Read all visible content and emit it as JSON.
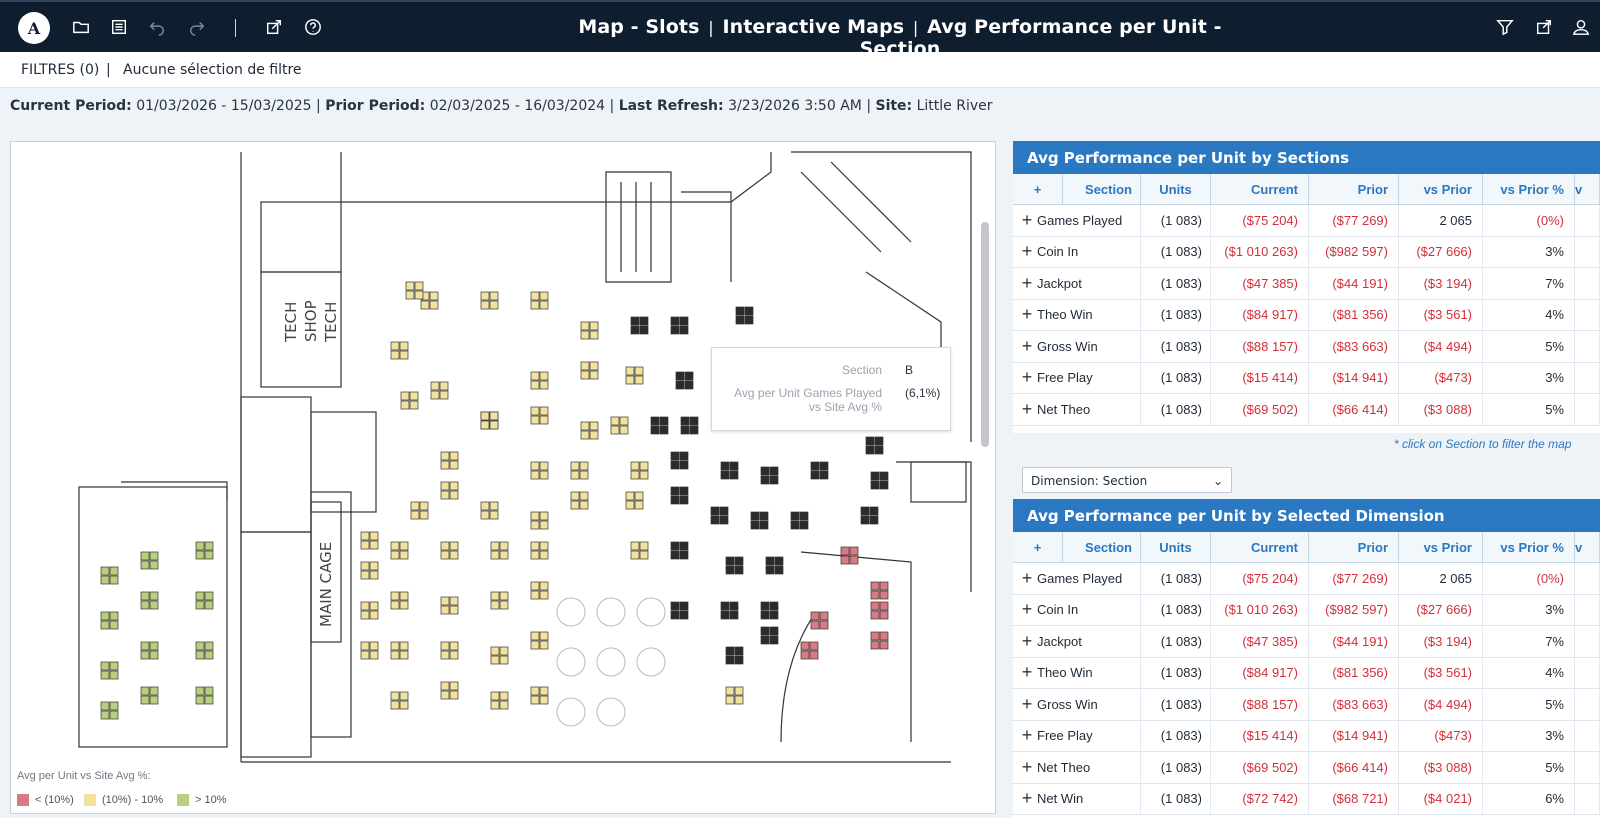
{
  "header": {
    "logo_text": "A",
    "title_parts": [
      "Map - Slots",
      "Interactive Maps",
      "Avg Performance per Unit - Section"
    ],
    "title_separator": "|"
  },
  "toolbar": {
    "left_icons": [
      "folder-icon",
      "list-icon",
      "undo-icon",
      "redo-icon",
      "divider",
      "export-icon",
      "help-icon"
    ],
    "right_icons": [
      "filter-icon",
      "share-icon",
      "user-icon"
    ]
  },
  "filters": {
    "label": "FILTRES (0)",
    "separator": "|",
    "value": "Aucune sélection de filtre"
  },
  "period": {
    "current_label": "Current Period:",
    "current_value": "01/03/2026 - 15/03/2025",
    "prior_label": "Prior Period:",
    "prior_value": "02/03/2025 - 16/03/2024",
    "refresh_label": "Last Refresh:",
    "refresh_value": "3/23/2026 3:50 AM",
    "site_label": "Site:",
    "site_value": "Little River",
    "sep": "|"
  },
  "map": {
    "labels": {
      "tech": "TECH",
      "shop": "SHOP",
      "tech2": "TECH",
      "main_cage": "MAIN CAGE"
    },
    "tooltip": {
      "k1": "Section",
      "v1": "B",
      "k2": "Avg per Unit Games Played",
      "k3": "vs Site Avg %",
      "v2": "(6,1%)"
    },
    "legend": {
      "title": "Avg per Unit vs Site Avg %:",
      "items": [
        {
          "label": "< (10%)",
          "color": "#d97b83"
        },
        {
          "label": "(10%) - 10%",
          "color": "#f2e2a0"
        },
        {
          "label": "> 10%",
          "color": "#b9cf7e"
        }
      ]
    }
  },
  "columns": {
    "section": "Section",
    "units": "Units",
    "current": "Current",
    "prior": "Prior",
    "vs_prior": "vs Prior",
    "vs_prior_pct": "vs Prior %",
    "extra": "v"
  },
  "table1": {
    "title": "Avg Performance per Unit by Sections",
    "rows": [
      {
        "name": "Games Played",
        "units": "(1 083)",
        "current": "($75 204)",
        "prior": "($77 269)",
        "vs_prior": "2 065",
        "vs_prior_pct": "(0%)"
      },
      {
        "name": "Coin In",
        "units": "(1 083)",
        "current": "($1 010 263)",
        "prior": "($982 597)",
        "vs_prior": "($27 666)",
        "vs_prior_pct": "3%"
      },
      {
        "name": "Jackpot",
        "units": "(1 083)",
        "current": "($47 385)",
        "prior": "($44 191)",
        "vs_prior": "($3 194)",
        "vs_prior_pct": "7%"
      },
      {
        "name": "Theo Win",
        "units": "(1 083)",
        "current": "($84 917)",
        "prior": "($81 356)",
        "vs_prior": "($3 561)",
        "vs_prior_pct": "4%"
      },
      {
        "name": "Gross Win",
        "units": "(1 083)",
        "current": "($88 157)",
        "prior": "($83 663)",
        "vs_prior": "($4 494)",
        "vs_prior_pct": "5%"
      },
      {
        "name": "Free Play",
        "units": "(1 083)",
        "current": "($15 414)",
        "prior": "($14 941)",
        "vs_prior": "($473)",
        "vs_prior_pct": "3%"
      },
      {
        "name": "Net Theo",
        "units": "(1 083)",
        "current": "($69 502)",
        "prior": "($66 414)",
        "vs_prior": "($3 088)",
        "vs_prior_pct": "5%"
      }
    ]
  },
  "note": "* click on Section to filter the map",
  "dimension_select": "Dimension: Section",
  "table2": {
    "title": "Avg Performance per Unit by Selected Dimension",
    "rows": [
      {
        "name": "Games Played",
        "units": "(1 083)",
        "current": "($75 204)",
        "prior": "($77 269)",
        "vs_prior": "2 065",
        "vs_prior_pct": "(0%)"
      },
      {
        "name": "Coin In",
        "units": "(1 083)",
        "current": "($1 010 263)",
        "prior": "($982 597)",
        "vs_prior": "($27 666)",
        "vs_prior_pct": "3%"
      },
      {
        "name": "Jackpot",
        "units": "(1 083)",
        "current": "($47 385)",
        "prior": "($44 191)",
        "vs_prior": "($3 194)",
        "vs_prior_pct": "7%"
      },
      {
        "name": "Theo Win",
        "units": "(1 083)",
        "current": "($84 917)",
        "prior": "($81 356)",
        "vs_prior": "($3 561)",
        "vs_prior_pct": "4%"
      },
      {
        "name": "Gross Win",
        "units": "(1 083)",
        "current": "($88 157)",
        "prior": "($83 663)",
        "vs_prior": "($4 494)",
        "vs_prior_pct": "5%"
      },
      {
        "name": "Free Play",
        "units": "(1 083)",
        "current": "($15 414)",
        "prior": "($14 941)",
        "vs_prior": "($473)",
        "vs_prior_pct": "3%"
      },
      {
        "name": "Net Theo",
        "units": "(1 083)",
        "current": "($69 502)",
        "prior": "($66 414)",
        "vs_prior": "($3 088)",
        "vs_prior_pct": "5%"
      },
      {
        "name": "Net Win",
        "units": "(1 083)",
        "current": "($72 742)",
        "prior": "($68 721)",
        "vs_prior": "($4 021)",
        "vs_prior_pct": "6%"
      }
    ]
  },
  "colors": {
    "header_bg": "#0e1e2f",
    "table_header": "#2b78c2",
    "negative": "#d1303a"
  }
}
